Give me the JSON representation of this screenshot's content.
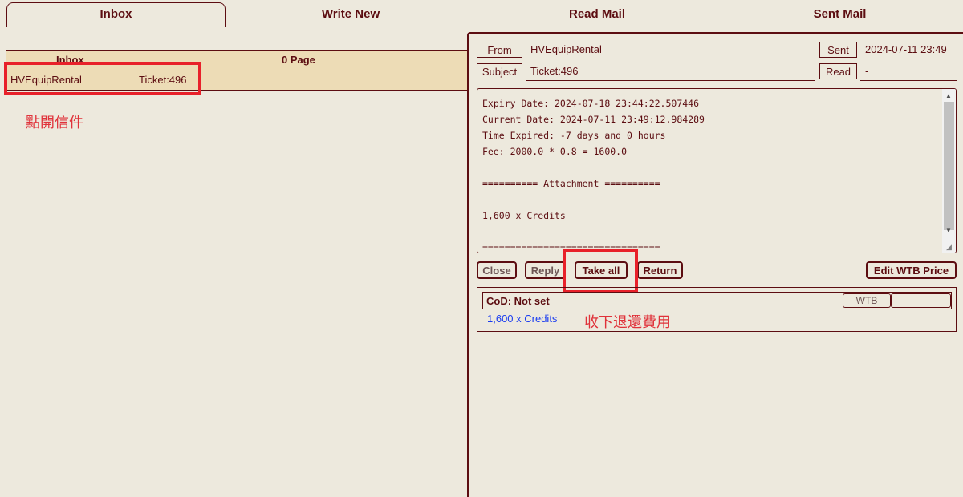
{
  "tabs": [
    "Inbox",
    "Write New",
    "Read Mail",
    "Sent Mail"
  ],
  "inbox": {
    "header_label": "Inbox",
    "page_label": "0 Page",
    "rows": [
      {
        "from": "HVEquipRental",
        "subject": "Ticket:496"
      }
    ]
  },
  "annotations": {
    "open_mail": "點開信件",
    "take_refund": "收下退還費用"
  },
  "mail": {
    "from_label": "From",
    "from_value": "HVEquipRental",
    "sent_label": "Sent",
    "sent_value": "2024-07-11 23:49",
    "subject_label": "Subject",
    "subject_value": "Ticket:496",
    "read_label": "Read",
    "read_value": "-",
    "body": "Expiry Date: 2024-07-18 23:44:22.507446\nCurrent Date: 2024-07-11 23:49:12.984289\nTime Expired: -7 days and 0 hours\nFee: 2000.0 * 0.8 = 1600.0\n\n========== Attachment ==========\n\n1,600 x Credits\n\n================================"
  },
  "buttons": {
    "close": "Close",
    "reply": "Reply",
    "take_all": "Take all",
    "return": "Return",
    "edit_wtb": "Edit WTB Price"
  },
  "attachment": {
    "cod_label": "CoD: Not set",
    "wtb_button": "WTB",
    "wtb_value": "",
    "item": "1,600 x Credits"
  },
  "colors": {
    "text": "#5c0d11",
    "background": "#ede9dd",
    "row_highlight": "#eddcb6",
    "annotation_red": "#e8212a",
    "link_blue": "#1a3cf0"
  }
}
